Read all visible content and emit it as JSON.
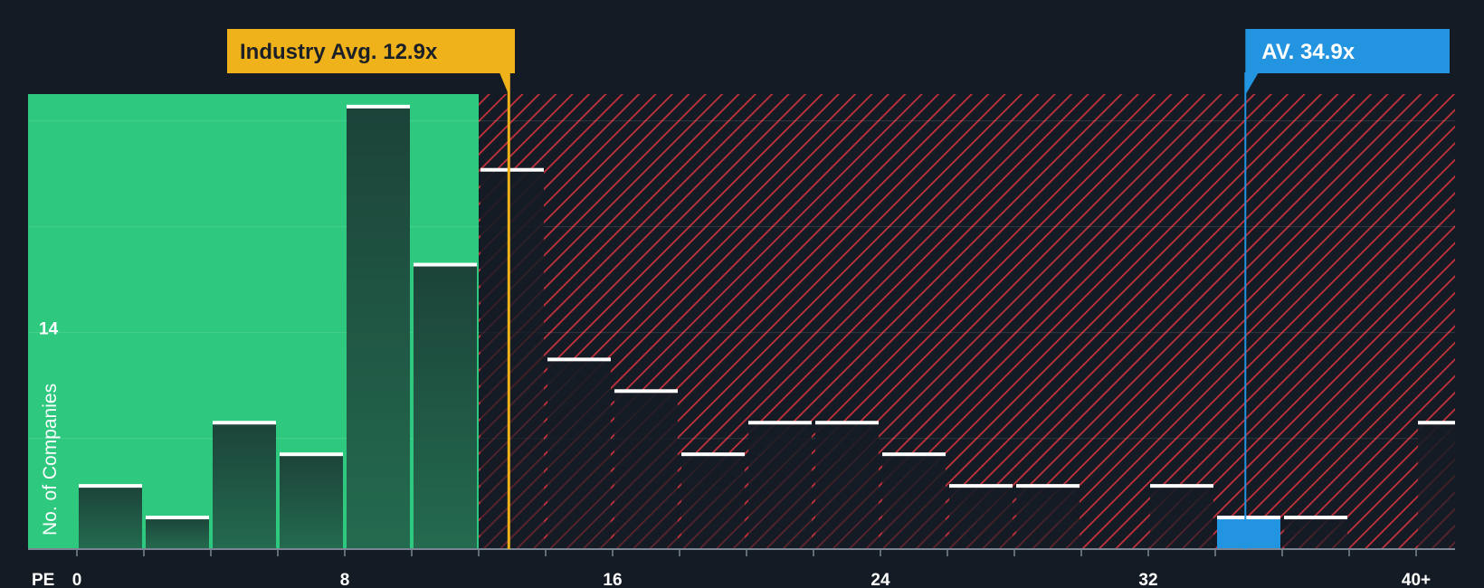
{
  "chart_data": {
    "type": "bar",
    "xlabel": "PE",
    "ylabel": "No. of Companies",
    "bin_start": [
      0,
      2,
      4,
      6,
      8,
      10,
      12,
      14,
      16,
      18,
      20,
      22,
      24,
      26,
      28,
      30,
      32,
      34,
      36,
      38,
      40
    ],
    "values": [
      4,
      2,
      8,
      6,
      28,
      18,
      24,
      12,
      10,
      6,
      8,
      8,
      6,
      4,
      4,
      0,
      4,
      2,
      2,
      0,
      8
    ],
    "highlight_bin": 34,
    "x_ticks": [
      {
        "value": 0,
        "label": "0"
      },
      {
        "value": 8,
        "label": "8"
      },
      {
        "value": 16,
        "label": "16"
      },
      {
        "value": 24,
        "label": "24"
      },
      {
        "value": 32,
        "label": "32"
      },
      {
        "value": 40,
        "label": "40+"
      }
    ],
    "y_tick_label": "14",
    "y_tick_value": 14,
    "industry_avg": {
      "value": 12.9,
      "label": "Industry Avg. 12.9x"
    },
    "company": {
      "value": 34.9,
      "label": "AV. 34.9x"
    },
    "colors": {
      "background": "#151b24",
      "undervalued_zone": "#2ec97e",
      "overvalued_zone": "#d8323c",
      "bar_dark": "#1f4a3e",
      "highlight_bar": "#2394e0",
      "industry_callout": "#efb21a",
      "company_callout": "#2394e0"
    }
  }
}
